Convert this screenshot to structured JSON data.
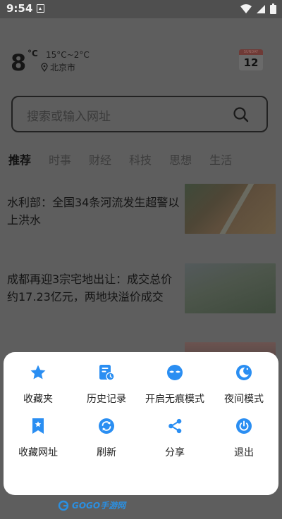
{
  "status_bar": {
    "time": "9:54"
  },
  "weather": {
    "temperature": "8",
    "unit": "°C",
    "range": "15°C~2°C",
    "location": "北京市"
  },
  "calendar": {
    "weekday": "SUNDAY",
    "day": "12"
  },
  "search": {
    "placeholder": "搜索或输入网址"
  },
  "tabs": [
    {
      "label": "推荐",
      "active": true
    },
    {
      "label": "时事"
    },
    {
      "label": "财经"
    },
    {
      "label": "科技"
    },
    {
      "label": "思想"
    },
    {
      "label": "生活"
    }
  ],
  "news": [
    {
      "title": "水利部：全国34条河流发生超警以上洪水"
    },
    {
      "title": "成都再迎3宗宅地出让：成交总价约17.23亿元，两地块溢价成交"
    }
  ],
  "menu": {
    "accent_color": "#2a8ef2",
    "items": [
      {
        "label": "收藏夹",
        "icon": "star-icon"
      },
      {
        "label": "历史记录",
        "icon": "history-icon"
      },
      {
        "label": "开启无痕模式",
        "icon": "incognito-icon"
      },
      {
        "label": "夜间模式",
        "icon": "night-mode-icon"
      },
      {
        "label": "收藏网址",
        "icon": "bookmark-icon"
      },
      {
        "label": "刷新",
        "icon": "refresh-icon"
      },
      {
        "label": "分享",
        "icon": "share-icon"
      },
      {
        "label": "退出",
        "icon": "power-icon"
      }
    ]
  },
  "watermark": {
    "text": "GOGO手游网"
  }
}
